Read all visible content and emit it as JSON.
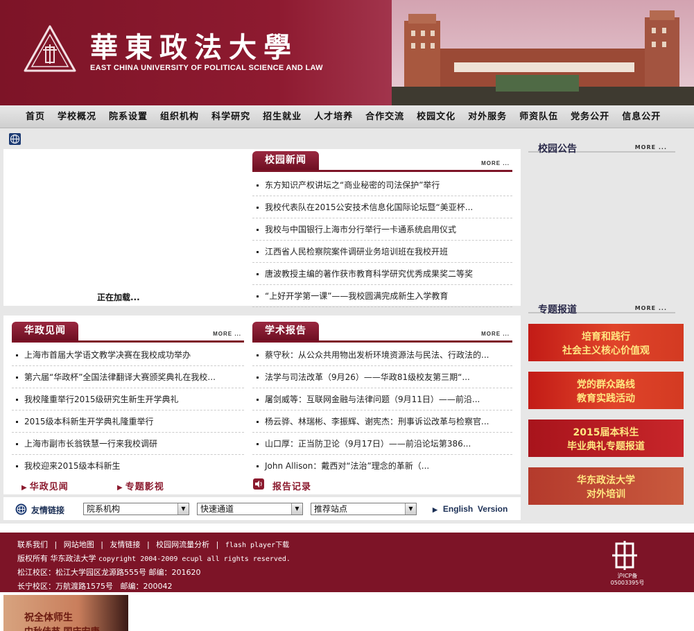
{
  "header": {
    "title_cn": "華東政法大學",
    "title_en": "EAST CHINA UNIVERSITY OF POLITICAL SCIENCE AND LAW",
    "colors": {
      "brand": "#7d1427",
      "nav_bg": "#dcdcdc"
    }
  },
  "nav": {
    "items": [
      "首页",
      "学校概况",
      "院系设置",
      "组织机构",
      "科学研究",
      "招生就业",
      "人才培养",
      "合作交流",
      "校园文化",
      "对外服务",
      "师资队伍",
      "党务公开",
      "信息公开"
    ]
  },
  "flash": {
    "loading_text": "正在加载..."
  },
  "news": {
    "title": "校园新闻",
    "more": "MORE ...",
    "items": [
      "东方知识产权讲坛之“商业秘密的司法保护”举行",
      "我校代表队在2015公安技术信息化国际论坛暨“美亚杯...",
      "我校与中国银行上海市分行举行一卡通系统启用仪式",
      "江西省人民检察院案件调研业务培训班在我校开班",
      "唐波教授主编的著作获市教育科学研究优秀成果奖二等奖",
      "“上好开学第一课”——我校圆满完成新生入学教育"
    ]
  },
  "huazheng": {
    "title": "华政见闻",
    "more": "MORE ...",
    "items": [
      "上海市首届大学语文教学决赛在我校成功举办",
      "第六届“华政杯”全国法律翻译大赛颁奖典礼在我校...",
      "我校隆重举行2015级研究生新生开学典礼",
      "2015级本科新生开学典礼隆重举行",
      "上海市副市长翁铁慧一行来我校调研",
      "我校迎来2015级本科新生"
    ],
    "link1": "华政见闻",
    "link2": "专题影视"
  },
  "academic": {
    "title": "学术报告",
    "more": "MORE ...",
    "items": [
      "蔡守秋：从公众共用物出发析环境资源法与民法、行政法的...",
      "法学与司法改革（9月26）——华政81级校友第三期“...",
      "屠剑威等：互联网金融与法律问题（9月11日）——前沿...",
      "杨云骅、林瑞彬、李振辉、谢宪杰：刑事诉讼改革与检察官...",
      "山口厚：正当防卫论（9月17日）——前沿论坛第386...",
      "John Allison：戴西对“法治”理念的革新（..."
    ],
    "link": "报告记录"
  },
  "sidebar": {
    "notice_title": "校园公告",
    "notice_more": "MORE ...",
    "topics_title": "专题报道",
    "topics_more": "MORE ...",
    "banners": [
      {
        "line1": "培育和践行",
        "line2": "社会主义核心价值观"
      },
      {
        "line1": "党的群众路线",
        "line2": "教育实践活动"
      },
      {
        "line1": "2015届本科生",
        "line2": "毕业典礼专题报道"
      },
      {
        "line1": "华东政法大学",
        "line2": "对外培训"
      }
    ]
  },
  "links": {
    "label": "友情链接",
    "select1": "院系机构",
    "select2": "快速通道",
    "select3": "推荐站点",
    "english": "English  Version"
  },
  "footer": {
    "line1_items": [
      "联系我们",
      "网站地图",
      "友情链接",
      "校园网流量分析",
      "flash player下载"
    ],
    "copyright_prefix": "版权所有 华东政法大学",
    "copyright_mono": "copyright 2004-2009 ecupl all rights reserved.",
    "addr1": "松江校区：松江大学园区龙源路555号 邮编：201620",
    "addr2": "长宁校区：万航渡路1575号   邮编：200042",
    "icp_line1": "沪ICP备",
    "icp_line2": "05003395号"
  },
  "popup": {
    "line1": "祝全体师生",
    "line2": "中秋佳节 国庆安康"
  }
}
